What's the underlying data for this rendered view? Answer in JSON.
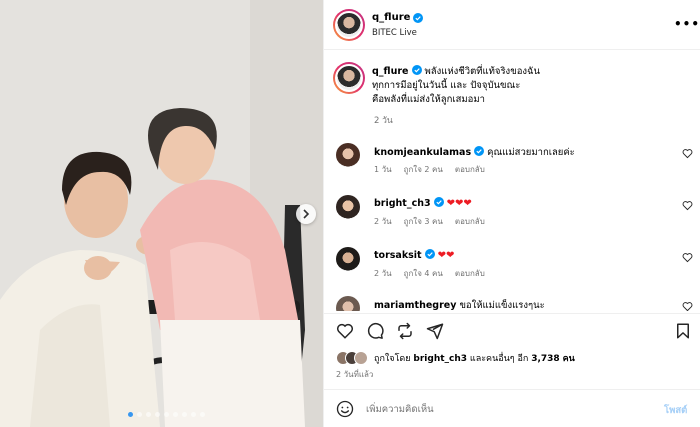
{
  "post": {
    "username": "q_flure",
    "location": "BITEC Live",
    "more_icon": "more-horizontal-icon",
    "carousel": {
      "slide_count": 9,
      "active_index": 0
    }
  },
  "caption": {
    "username": "q_flure",
    "line1": "พลังแห่งชีวิตที่แท้จริงของฉัน",
    "line2": "ทุกการมีอยู่ในวันนี้ และ ปัจจุบันขณะ",
    "line3": "คือพลังที่แม่ส่งให้ลูกเสมอมา",
    "time": "2 วัน"
  },
  "comments": [
    {
      "username": "knomjeankulamas",
      "verified": true,
      "text": "คุณแม่สวยมากเลยค่ะ",
      "time": "1 วัน",
      "likes": "ถูกใจ 2 คน",
      "reply": "ตอบกลับ"
    },
    {
      "username": "bright_ch3",
      "verified": true,
      "text": "❤❤❤",
      "time": "2 วัน",
      "likes": "ถูกใจ 3 คน",
      "reply": "ตอบกลับ"
    },
    {
      "username": "torsaksit",
      "verified": true,
      "text": "❤❤",
      "time": "2 วัน",
      "likes": "ถูกใจ 4 คน",
      "reply": "ตอบกลับ"
    },
    {
      "username": "mariamthegrey",
      "verified": false,
      "text": "ขอให้แม่แข็งแรงๆนะ",
      "time": "",
      "likes": "",
      "reply": ""
    }
  ],
  "likes": {
    "prefix": "ถูกใจโดย",
    "user": "bright_ch3",
    "middle": "และคนอื่นๆ อีก",
    "count": "3,738",
    "suffix": "คน"
  },
  "post_time": "2 วันที่แล้ว",
  "comment_box": {
    "placeholder": "เพิ่มความคิดเห็น",
    "post_label": "โพสต์"
  },
  "colors": {
    "accent": "#3797f0",
    "verified": "#0095f6",
    "heart": "#ed1c24"
  }
}
